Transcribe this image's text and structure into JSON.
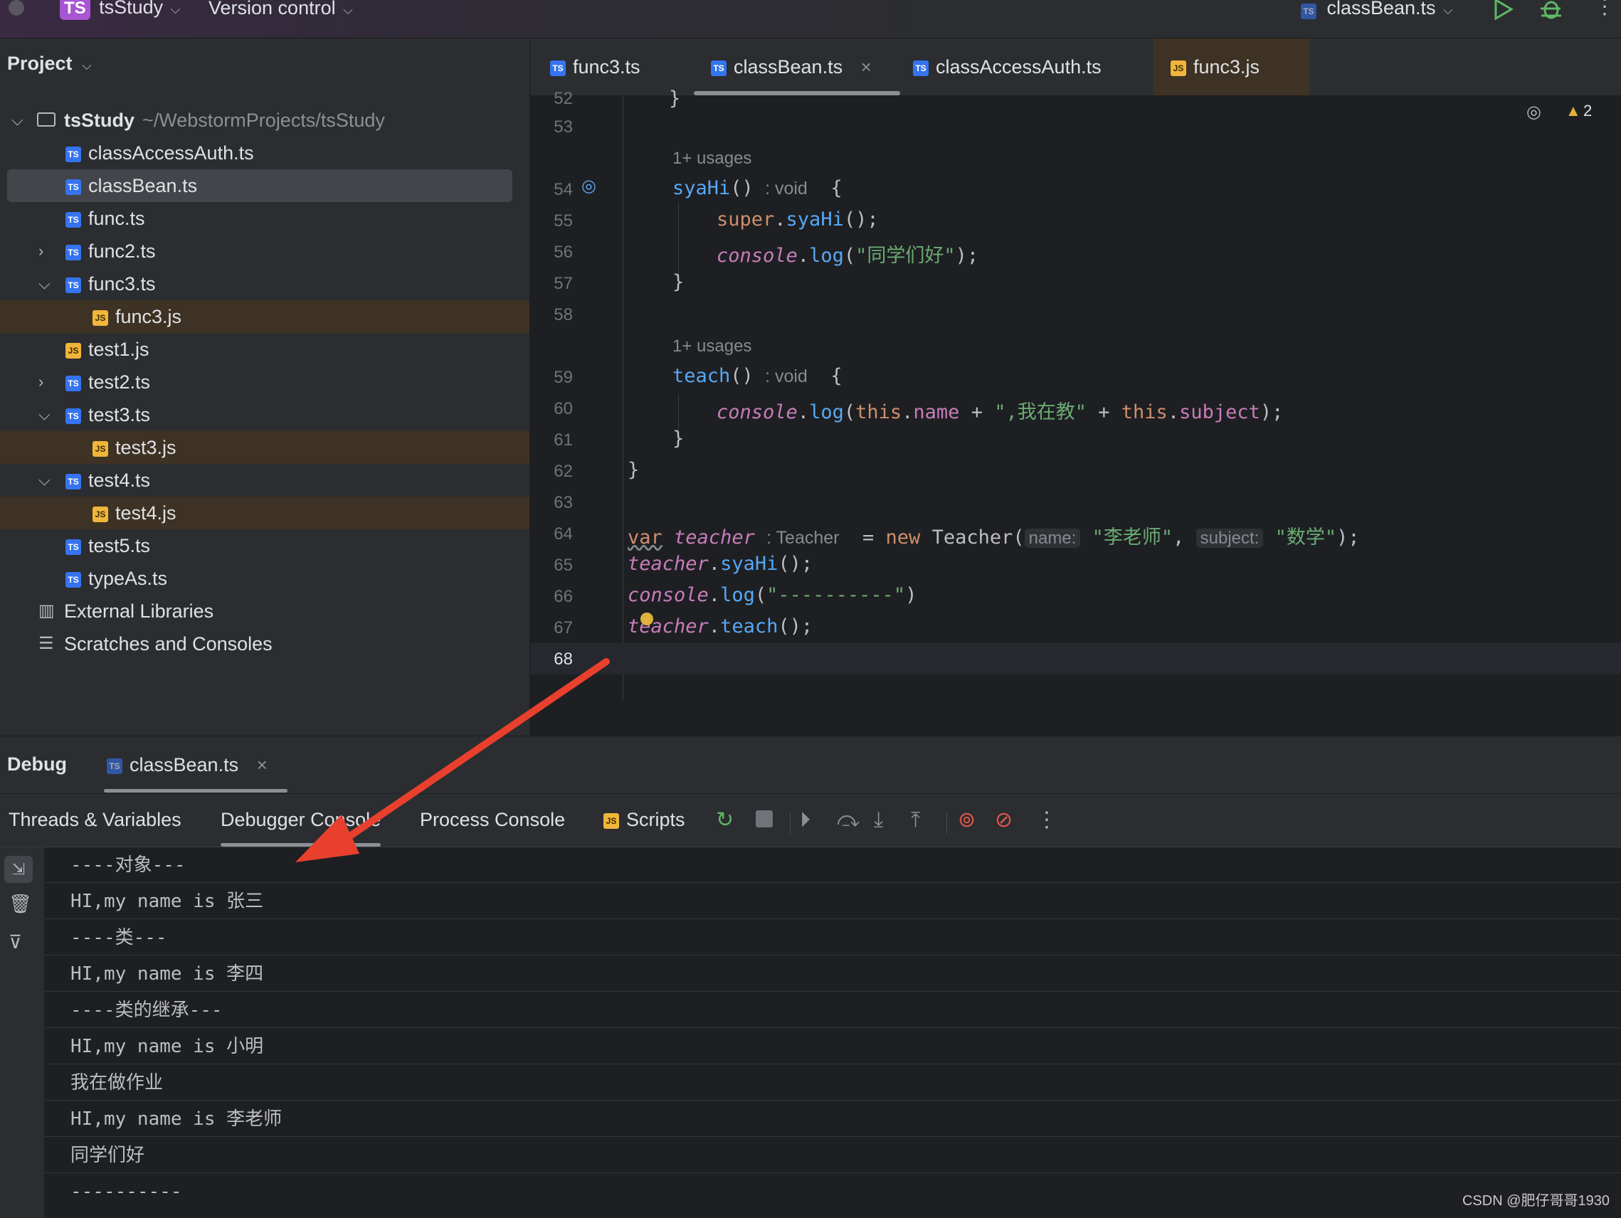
{
  "titlebar": {
    "project_badge": "TS",
    "project_name": "tsStudy",
    "vcs": "Version control",
    "run_config_icon": "TS",
    "run_config": "classBean.ts"
  },
  "project_panel": {
    "title": "Project",
    "root_name": "tsStudy",
    "root_path": "~/WebstormProjects/tsStudy",
    "items": [
      {
        "label": "classAccessAuth.ts",
        "type": "TS"
      },
      {
        "label": "classBean.ts",
        "type": "TS"
      },
      {
        "label": "func.ts",
        "type": "TS"
      },
      {
        "label": "func2.ts",
        "type": "TS"
      },
      {
        "label": "func3.ts",
        "type": "TS"
      },
      {
        "label": "func3.js",
        "type": "JS"
      },
      {
        "label": "test1.js",
        "type": "JS"
      },
      {
        "label": "test2.ts",
        "type": "TS"
      },
      {
        "label": "test3.ts",
        "type": "TS"
      },
      {
        "label": "test3.js",
        "type": "JS"
      },
      {
        "label": "test4.ts",
        "type": "TS"
      },
      {
        "label": "test4.js",
        "type": "JS"
      },
      {
        "label": "test5.ts",
        "type": "TS"
      },
      {
        "label": "typeAs.ts",
        "type": "TS"
      }
    ],
    "external_libraries": "External Libraries",
    "scratches": "Scratches and Consoles"
  },
  "editor_tabs": [
    {
      "label": "func3.ts",
      "type": "TS"
    },
    {
      "label": "classBean.ts",
      "type": "TS"
    },
    {
      "label": "classAccessAuth.ts",
      "type": "TS"
    },
    {
      "label": "func3.js",
      "type": "JS"
    }
  ],
  "editor": {
    "warnings_count": "2",
    "usages_1": "1+ usages",
    "usages_2": "1+ usages",
    "line_numbers": [
      "52",
      "53",
      "54",
      "55",
      "56",
      "57",
      "58",
      "59",
      "60",
      "61",
      "62",
      "63",
      "64",
      "65",
      "66",
      "67",
      "68"
    ],
    "code": {
      "l52": "}",
      "l54_fn": "syaHi",
      "l54_rest": "()",
      "l54_hint": ": void",
      "l54_brace": "{",
      "l55_kw": "super",
      "l55_fn": "syaHi",
      "l55_rest": "();",
      "l56_obj": "console",
      "l56_fn": "log",
      "l56_str": "\"同学们好\"",
      "l57": "}",
      "l59_fn": "teach",
      "l59_rest": "()",
      "l59_hint": ": void",
      "l59_brace": "{",
      "l60_obj": "console",
      "l60_fn": "log",
      "l60_this1": "this",
      "l60_name": "name",
      "l60_str": "\",我在教\"",
      "l60_this2": "this",
      "l60_subject": "subject",
      "l61": "}",
      "l62": "}",
      "l64_var": "var",
      "l64_ident": "teacher",
      "l64_hint": ": Teacher",
      "l64_new": "new",
      "l64_cls": "Teacher(",
      "l64_hint_name": "name:",
      "l64_str_name": "\"李老师\"",
      "l64_hint_subject": "subject:",
      "l64_str_subject": "\"数学\"",
      "l64_end": ");",
      "l65_ident": "teacher",
      "l65_fn": "syaHi",
      "l65_rest": "();",
      "l66_obj": "console",
      "l66_fn": "log",
      "l66_str": "\"----------\"",
      "l66_end": ")",
      "l67_ident": "teacher",
      "l67_fn": "teach",
      "l67_rest": "();"
    }
  },
  "debug": {
    "title": "Debug",
    "session_tab": "classBean.ts",
    "tabs": [
      "Threads & Variables",
      "Debugger Console",
      "Process Console",
      "Scripts"
    ],
    "console_lines": [
      "----对象---",
      "HI,my name is 张三",
      "----类---",
      "HI,my name is 李四",
      "----类的继承---",
      "HI,my name is 小明",
      "我在做作业",
      "HI,my name is 李老师",
      "同学们好",
      "----------"
    ]
  },
  "watermark": "CSDN @肥仔哥哥1930",
  "colors": {
    "accent_arrow": "#e8402d",
    "ts_icon": "#3574f0",
    "js_icon": "#f0b53b",
    "string": "#6aab73",
    "keyword": "#cf8e6d",
    "function": "#56a8f5",
    "italic_ident": "#c77dbb"
  }
}
